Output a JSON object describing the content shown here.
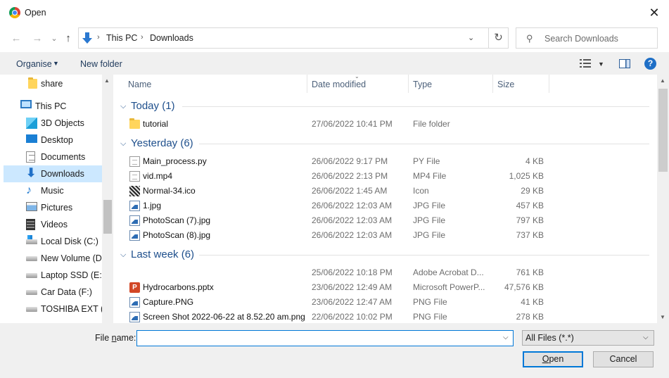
{
  "window": {
    "title": "Open",
    "close_glyph": "✕"
  },
  "nav": {
    "back_glyph": "←",
    "forward_glyph": "→",
    "dropdown_glyph": "⌄",
    "up_glyph": "↑",
    "breadcrumbs": [
      "This PC",
      "Downloads"
    ],
    "breadcrumb_sep": "›",
    "refresh_glyph": "↻",
    "search_placeholder": "Search Downloads"
  },
  "toolbar": {
    "organise": "Organise",
    "new_folder": "New folder"
  },
  "sidebar": {
    "items": [
      {
        "label": "share",
        "icon": "folder-icon"
      },
      {
        "label": "This PC",
        "icon": "computer-icon"
      },
      {
        "label": "3D Objects",
        "icon": "3d-objects-icon"
      },
      {
        "label": "Desktop",
        "icon": "desktop-icon"
      },
      {
        "label": "Documents",
        "icon": "documents-icon"
      },
      {
        "label": "Downloads",
        "icon": "downloads-icon",
        "selected": true
      },
      {
        "label": "Music",
        "icon": "music-icon"
      },
      {
        "label": "Pictures",
        "icon": "pictures-icon"
      },
      {
        "label": "Videos",
        "icon": "videos-icon"
      },
      {
        "label": "Local Disk (C:)",
        "icon": "windows-drive-icon"
      },
      {
        "label": "New Volume (D:)",
        "icon": "drive-icon"
      },
      {
        "label": "Laptop SSD (E:)",
        "icon": "drive-icon"
      },
      {
        "label": "Car Data (F:)",
        "icon": "drive-icon"
      },
      {
        "label": "TOSHIBA EXT (H:)",
        "icon": "drive-icon"
      }
    ]
  },
  "columns": {
    "name": "Name",
    "date": "Date modified",
    "type": "Type",
    "size": "Size"
  },
  "groups": [
    {
      "title": "Today (1)",
      "rows": [
        {
          "name": "tutorial",
          "date": "27/06/2022 10:41 PM",
          "type": "File folder",
          "size": "",
          "icon": "folder-icon"
        }
      ]
    },
    {
      "title": "Yesterday (6)",
      "rows": [
        {
          "name": "Main_process.py",
          "date": "26/06/2022 9:17 PM",
          "type": "PY File",
          "size": "4 KB",
          "icon": "file-icon"
        },
        {
          "name": "vid.mp4",
          "date": "26/06/2022 2:13 PM",
          "type": "MP4 File",
          "size": "1,025 KB",
          "icon": "file-icon"
        },
        {
          "name": "Normal-34.ico",
          "date": "26/06/2022 1:45 AM",
          "type": "Icon",
          "size": "29 KB",
          "icon": "ico-file-icon"
        },
        {
          "name": "1.jpg",
          "date": "26/06/2022 12:03 AM",
          "type": "JPG File",
          "size": "457 KB",
          "icon": "image-file-icon"
        },
        {
          "name": "PhotoScan (7).jpg",
          "date": "26/06/2022 12:03 AM",
          "type": "JPG File",
          "size": "797 KB",
          "icon": "image-file-icon"
        },
        {
          "name": "PhotoScan (8).jpg",
          "date": "26/06/2022 12:03 AM",
          "type": "JPG File",
          "size": "737 KB",
          "icon": "image-file-icon"
        }
      ]
    },
    {
      "title": "Last week (6)",
      "rows": [
        {
          "name": "",
          "date": "25/06/2022 10:18 PM",
          "type": "Adobe Acrobat D...",
          "size": "761 KB",
          "icon": ""
        },
        {
          "name": "Hydrocarbons.pptx",
          "date": "23/06/2022 12:49 AM",
          "type": "Microsoft PowerP...",
          "size": "47,576 KB",
          "icon": "powerpoint-icon"
        },
        {
          "name": "Capture.PNG",
          "date": "23/06/2022 12:47 AM",
          "type": "PNG File",
          "size": "41 KB",
          "icon": "image-file-icon"
        },
        {
          "name": "Screen Shot 2022-06-22 at 8.52.20 am.png",
          "date": "22/06/2022 10:02 PM",
          "type": "PNG File",
          "size": "278 KB",
          "icon": "image-file-icon"
        }
      ]
    }
  ],
  "bottom": {
    "file_name_label_prefix": "File ",
    "file_name_label_accel": "n",
    "file_name_label_suffix": "ame:",
    "file_name_value": "",
    "filter": "All Files (*.*)",
    "open_accel": "O",
    "open_rest": "pen",
    "cancel": "Cancel"
  }
}
